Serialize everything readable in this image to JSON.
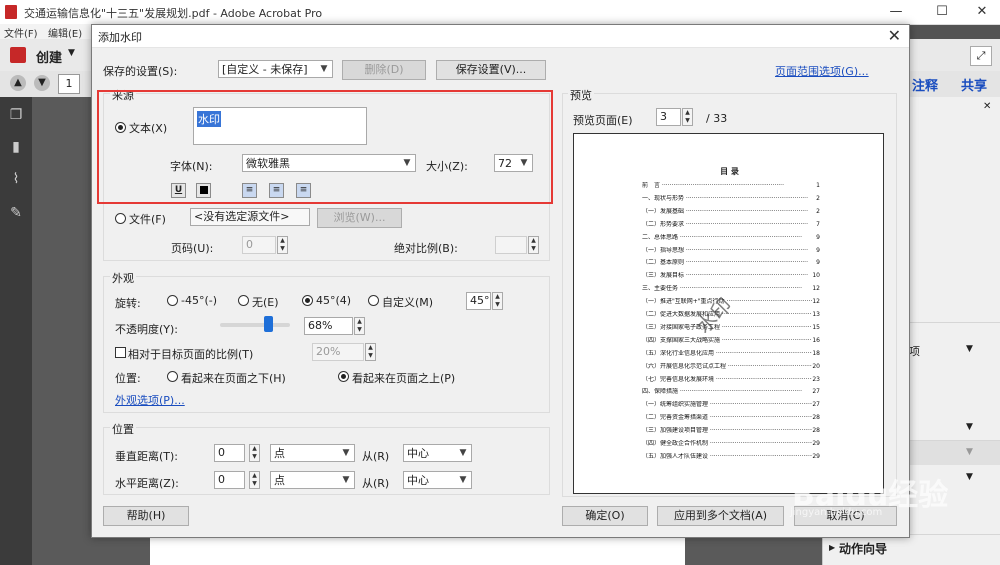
{
  "app": {
    "window_title": "交通运输信息化\"十三五\"发展规划.pdf - Adobe Acrobat Pro",
    "menu": [
      "文件(F)",
      "编辑(E)"
    ],
    "create_label": "创建",
    "page_number": "1",
    "right_tabs": [
      "注释",
      "共享"
    ],
    "right_pane_items": [
      "项",
      "动作向导"
    ]
  },
  "dialog": {
    "title": "添加水印",
    "saved_settings": {
      "label": "保存的设置(S):",
      "value": "[自定义 - 未保存]",
      "delete_label": "删除(D)",
      "save_label": "保存设置(V)..."
    },
    "page_range_link": "页面范围选项(G)...",
    "source": {
      "group_label": "来源",
      "text_label": "文本(X)",
      "text_value": "水印",
      "font_label": "字体(N):",
      "font_value": "微软雅黑",
      "size_label": "大小(Z):",
      "size_value": "72",
      "underline": "U",
      "file_label": "文件(F)",
      "file_value": "<没有选定源文件>",
      "browse_label": "浏览(W)...",
      "page_label": "页码(U):",
      "page_value": "0",
      "scale_label": "绝对比例(B):",
      "scale_value": ""
    },
    "appearance": {
      "group_label": "外观",
      "rotation_label": "旋转:",
      "rot_options": [
        "-45°(-)",
        "无(E)",
        "45°(4)",
        "自定义(M)"
      ],
      "rot_selected": 2,
      "rot_custom_value": "45°",
      "opacity_label": "不透明度(Y):",
      "opacity_value": "68%",
      "opacity_level": 0.68,
      "relative_label": "相对于目标页面的比例(T)",
      "relative_value": "20%",
      "position_label": "位置:",
      "pos_below": "看起来在页面之下(H)",
      "pos_above": "看起来在页面之上(P)",
      "options_link": "外观选项(P)..."
    },
    "position": {
      "group_label": "位置",
      "vertical_label": "垂直距离(T):",
      "vertical_value": "0",
      "vertical_unit": "点",
      "from_label": "从(R)",
      "vertical_from": "中心",
      "horizontal_label": "水平距离(Z):",
      "horizontal_value": "0",
      "horizontal_unit": "点",
      "horizontal_from": "中心"
    },
    "preview": {
      "group_label": "预览",
      "page_label": "预览页面(E)",
      "page_value": "3",
      "page_total": "/ 33",
      "doc_title": "目 录",
      "watermark_text": "水印",
      "toc": [
        {
          "t": "前　言",
          "p": "1"
        },
        {
          "t": "一、现状与形势",
          "p": "2"
        },
        {
          "t": "（一）发展基础",
          "p": "2"
        },
        {
          "t": "（二）形势要求",
          "p": "7"
        },
        {
          "t": "二、总体思路",
          "p": "9"
        },
        {
          "t": "（一）指导思想",
          "p": "9"
        },
        {
          "t": "（二）基本原则",
          "p": "9"
        },
        {
          "t": "（三）发展目标",
          "p": "10"
        },
        {
          "t": "三、主要任务",
          "p": "12"
        },
        {
          "t": "（一）推进\"互联网+\"重点行动",
          "p": "12"
        },
        {
          "t": "（二）促进大数据发展和应用",
          "p": "13"
        },
        {
          "t": "（三）对接国家电子政务工程",
          "p": "15"
        },
        {
          "t": "（四）支撑国家三大战略实施",
          "p": "16"
        },
        {
          "t": "（五）深化行业信息化应用",
          "p": "18"
        },
        {
          "t": "（六）开展信息化示范试点工程",
          "p": "20"
        },
        {
          "t": "（七）完善信息化发展环境",
          "p": "23"
        },
        {
          "t": "四、保障措施",
          "p": "27"
        },
        {
          "t": "（一）统筹组织实施管理",
          "p": "27"
        },
        {
          "t": "（二）完善资金筹措渠道",
          "p": "28"
        },
        {
          "t": "（三）加强建设项目管理",
          "p": "28"
        },
        {
          "t": "（四）健全政企合作机制",
          "p": "29"
        },
        {
          "t": "（五）加强人才队伍建设",
          "p": "29"
        }
      ]
    },
    "help_label": "帮助(H)",
    "ok_label": "确定(O)",
    "apply_multi_label": "应用到多个文档(A)",
    "cancel_label": "取消(C)"
  },
  "overlay": {
    "baidu_logo": "Baidu经验",
    "baidu_url": "jingyan.baidu.com"
  }
}
